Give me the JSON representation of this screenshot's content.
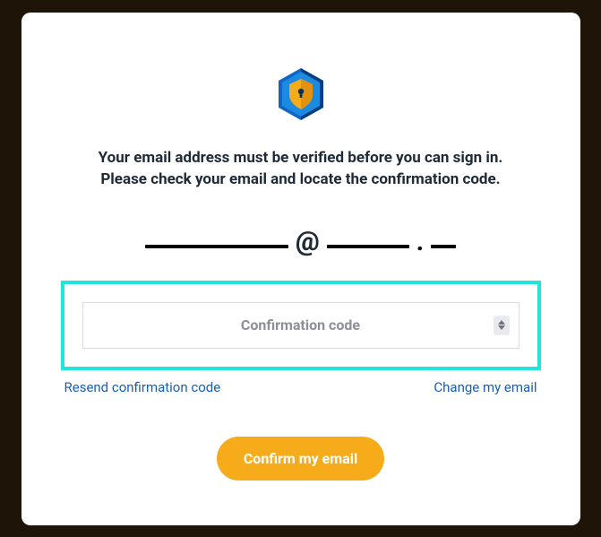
{
  "instructions": {
    "line1": "Your email address must be verified before you can sign in.",
    "line2": "Please check your email and locate the confirmation code."
  },
  "email_at": "@",
  "code_input": {
    "placeholder": "Confirmation code",
    "value": ""
  },
  "links": {
    "resend": "Resend confirmation code",
    "change": "Change my email"
  },
  "buttons": {
    "confirm": "Confirm my email"
  },
  "colors": {
    "accent": "#f6ac1a",
    "highlight": "#1fe6d8",
    "link": "#1a5fb4"
  }
}
